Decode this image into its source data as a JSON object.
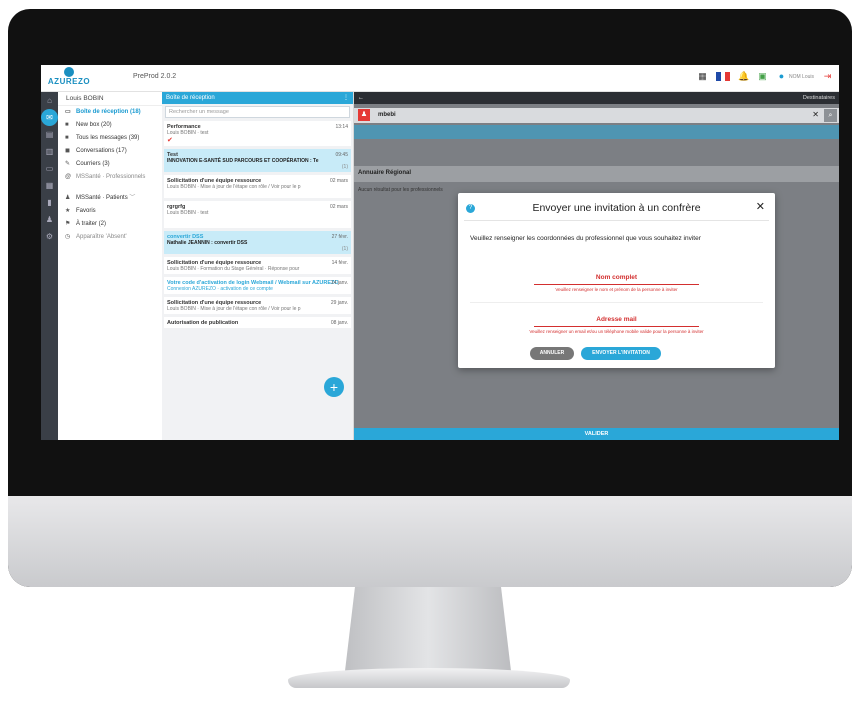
{
  "app": {
    "logo_text": "AZUREZO",
    "version": "PreProd 2.0.2"
  },
  "topbar": {
    "user_label": "NOM Louis"
  },
  "sidebar": {
    "user": "Louis BOBIN",
    "items": [
      {
        "label": "Boîte de réception (18)",
        "icon": "inbox-icon"
      },
      {
        "label": "New box (20)",
        "icon": "mailbox-icon"
      },
      {
        "label": "Tous les messages (39)",
        "icon": "mailbox-icon"
      },
      {
        "label": "Conversations (17)",
        "icon": "chat-icon"
      },
      {
        "label": "Courriers (3)",
        "icon": "pen-icon"
      },
      {
        "label": "MSSanté · Professionnels",
        "icon": "at-icon"
      },
      {
        "label": "MSSanté · Patients",
        "icon": "user-icon"
      },
      {
        "label": "Favoris",
        "icon": "star-icon"
      },
      {
        "label": "À traiter (2)",
        "icon": "flag-icon"
      },
      {
        "label": "Apparaître 'Absent'",
        "icon": "clock-icon"
      }
    ]
  },
  "messages": {
    "header": "Boîte de réception",
    "badge": "",
    "search_placeholder": "Rechercher un message",
    "items": [
      {
        "title": "Performance",
        "sub": "Louis BOBIN · test",
        "date": "13:14",
        "extra": "",
        "selected": false
      },
      {
        "title": "Test",
        "sub": "INNOVATION E-SANTÉ SUD PARCOURS ET COOPÉRATION : Te",
        "date": "09:45",
        "extra": "(1)",
        "selected": true
      },
      {
        "title": "Sollicitation d'une équipe ressource",
        "sub": "Louis BOBIN · Mise à jour de l'étape con rôle / Voir pour le p",
        "date": "02 mars",
        "extra": "",
        "selected": false
      },
      {
        "title": "rgrgrfg",
        "sub": "Louis BOBIN · test",
        "date": "02 mars",
        "extra": "",
        "selected": false
      },
      {
        "title": "convertir DSS",
        "sub": "Nathalie JEANNIN : convertir DSS",
        "date": "27 févr.",
        "extra": "(1)",
        "selected": true
      },
      {
        "title": "Sollicitation d'une équipe ressource",
        "sub": "Louis BOBIN · Formation du Stage Général · Réponse pour",
        "date": "14 févr.",
        "extra": "",
        "selected": false
      },
      {
        "title": "Votre code d'activation de login Webmail / Webmail sur AZUREZO",
        "sub": "Connexion AZUREZO · activation de ce compte",
        "date": "14 janv.",
        "extra": "",
        "selected": false
      },
      {
        "title": "Sollicitation d'une équipe ressource",
        "sub": "Louis BOBIN · Mise à jour de l'étape con rôle / Voir pour le p",
        "date": "29 janv.",
        "extra": "",
        "selected": false
      },
      {
        "title": "Autorisation de publication",
        "sub": "",
        "date": "08 janv.",
        "extra": "",
        "selected": false
      }
    ]
  },
  "main": {
    "top_right": "Destinataires",
    "recipient_name": "mbebi",
    "annuaire_label": "Annuaire Régional",
    "no_result": "Aucun résultat pour les professionnels",
    "valider": "VALIDER"
  },
  "modal": {
    "title": "Envoyer une invitation à un confrère",
    "intro": "Veuillez renseigner les coordonnées du professionnel que vous souhaitez inviter",
    "name_label": "Nom complet",
    "name_help": "Veuillez renseigner le nom et prénom de la personne à inviter",
    "email_label": "Adresse mail",
    "email_help": "Veuillez renseigner un email et/ou un téléphone mobile valide pour la personne à inviter",
    "cancel": "ANNULER",
    "send": "ENVOYER L'INVITATION"
  },
  "colors": {
    "accent": "#2aa7d8",
    "error": "#d32f2f",
    "rail": "#3a3f47"
  }
}
